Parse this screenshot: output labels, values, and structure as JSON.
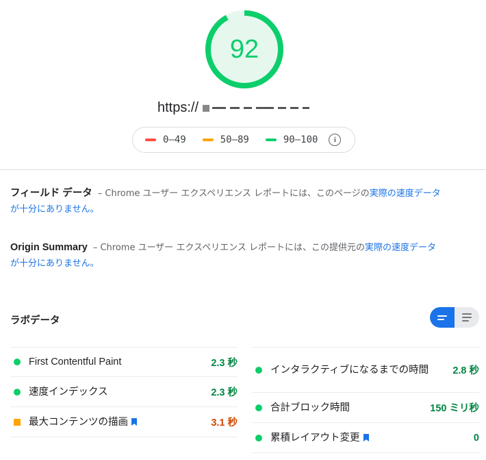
{
  "score": {
    "value": "92",
    "fraction": 0.92,
    "color": "#0cce6b"
  },
  "url": {
    "prefix": "https://"
  },
  "legend": [
    {
      "label": "0–49",
      "color": "#ff4e42"
    },
    {
      "label": "50–89",
      "color": "#ffa400"
    },
    {
      "label": "90–100",
      "color": "#0cce6b"
    }
  ],
  "legend_info_icon": "info-icon",
  "field_data": {
    "heading": "フィールド データ",
    "text": "– Chrome ユーザー エクスペリエンス レポートには、このページの",
    "link": "実際の速度データが十分にありません。"
  },
  "origin_summary": {
    "heading": "Origin Summary",
    "text": "– Chrome ユーザー エクスペリエンス レポートには、この提供元の",
    "link": "実際の速度データが十分にありません。"
  },
  "lab": {
    "title": "ラボデータ",
    "toggle_colors": {
      "active": "#1a73e8",
      "inactive": "#e8eaed"
    }
  },
  "metrics_left": [
    {
      "name": "First Contentful Paint",
      "value": "2.3 秒",
      "status": "good",
      "flag": false
    },
    {
      "name": "速度インデックス",
      "value": "2.3 秒",
      "status": "good",
      "flag": false
    },
    {
      "name": "最大コンテンツの描画",
      "value": "3.1 秒",
      "status": "average",
      "flag": true
    }
  ],
  "metrics_right": [
    {
      "name": "インタラクティブになるまでの時間",
      "value": "2.8 秒",
      "status": "good",
      "flag": false
    },
    {
      "name": "合計ブロック時間",
      "value": "150 ミリ秒",
      "status": "good",
      "flag": false
    },
    {
      "name": "累積レイアウト変更",
      "value": "0",
      "status": "good",
      "flag": true
    }
  ]
}
